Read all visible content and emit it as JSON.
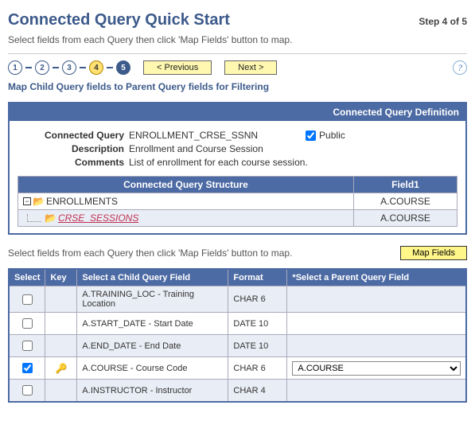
{
  "header": {
    "title": "Connected Query Quick Start",
    "step_label": "Step 4 of 5",
    "instruction": "Select fields from each Query then click 'Map Fields' button to map."
  },
  "nav": {
    "steps": [
      "1",
      "2",
      "3",
      "4",
      "5"
    ],
    "current_step_index": 3,
    "prev_label": "< Previous",
    "next_label": "Next >",
    "help_tooltip": "Help"
  },
  "sub_instruction": "Map Child Query fields to Parent Query fields for Filtering",
  "definition": {
    "panel_title": "Connected Query Definition",
    "labels": {
      "conn_query": "Connected Query",
      "description": "Description",
      "comments": "Comments",
      "public": "Public"
    },
    "values": {
      "conn_query": "ENROLLMENT_CRSE_SSNN",
      "description": "Enrollment and Course Session",
      "comments": "List of enrollment for each course session.",
      "public_checked": true
    },
    "structure_headers": {
      "structure": "Connected Query Structure",
      "field1": "Field1"
    },
    "structure_rows": [
      {
        "label": "ENROLLMENTS",
        "field1": "A.COURSE",
        "is_child": false
      },
      {
        "label": "CRSE_SESSIONS",
        "field1": "A.COURSE",
        "is_child": true
      }
    ]
  },
  "map": {
    "instruction2": "Select fields from each Query then click 'Map Fields' button to map.",
    "button": "Map Fields"
  },
  "grid": {
    "headers": {
      "select": "Select",
      "key": "Key",
      "child": "Select a Child Query Field",
      "format": "Format",
      "parent": "*Select a Parent Query Field"
    },
    "rows": [
      {
        "select": false,
        "key": false,
        "child": "A.TRAINING_LOC - Training Location",
        "format": "CHAR 6",
        "parent": ""
      },
      {
        "select": false,
        "key": false,
        "child": "A.START_DATE - Start Date",
        "format": "DATE 10",
        "parent": ""
      },
      {
        "select": false,
        "key": false,
        "child": "A.END_DATE - End Date",
        "format": "DATE 10",
        "parent": ""
      },
      {
        "select": true,
        "key": true,
        "child": "A.COURSE - Course Code",
        "format": "CHAR 6",
        "parent": "A.COURSE"
      },
      {
        "select": false,
        "key": false,
        "child": "A.INSTRUCTOR - Instructor",
        "format": "CHAR 4",
        "parent": ""
      }
    ]
  }
}
